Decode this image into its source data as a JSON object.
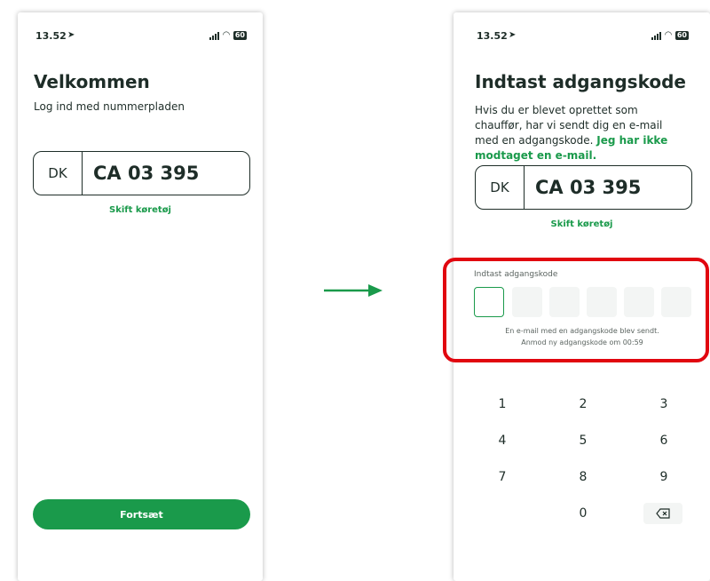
{
  "left": {
    "status": {
      "time": "13.52",
      "battery": "60"
    },
    "title": "Velkommen",
    "subtitle": "Log ind med nummerpladen",
    "plate": {
      "country": "DK",
      "number": "CA 03 395"
    },
    "change_vehicle": "Skift køretøj",
    "continue_button": "Fortsæt"
  },
  "right": {
    "status": {
      "time": "13.52",
      "battery": "60"
    },
    "title": "Indtast adgangskode",
    "description": "Hvis du er blevet oprettet som chauffør, har vi sendt dig en e-mail med en adgangskode.",
    "not_received_link": "Jeg har ikke modtaget en e-mail.",
    "plate": {
      "country": "DK",
      "number": "CA 03 395"
    },
    "change_vehicle": "Skift køretøj",
    "code_label": "Indtast adgangskode",
    "hint_line1": "En e-mail med en adgangskode blev sendt.",
    "hint_line2": "Anmod ny adgangskode om 00:59",
    "keypad": [
      "1",
      "2",
      "3",
      "4",
      "5",
      "6",
      "7",
      "8",
      "9",
      "0"
    ]
  },
  "colors": {
    "accent": "#1a9a4b",
    "highlight": "#e1060f",
    "text": "#1e2d28"
  },
  "icons": {
    "arrow": "right-arrow-icon",
    "backspace": "backspace-icon",
    "location": "location-arrow-icon"
  }
}
